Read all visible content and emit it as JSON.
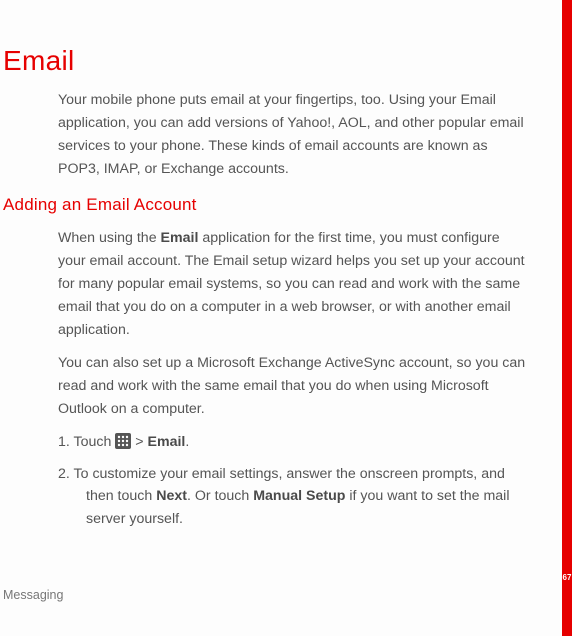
{
  "colors": {
    "accent": "#e60000",
    "text": "#555555"
  },
  "page_number": "67",
  "footer": "Messaging",
  "heading": "Email",
  "intro": "Your mobile phone puts email at your fingertips, too. Using your Email application, you can add versions of Yahoo!, AOL, and other popular email services to your phone. These kinds of email accounts are known as POP3, IMAP, or Exchange accounts.",
  "subheading": "Adding an Email Account",
  "para1_a": "When using the ",
  "para1_bold": "Email",
  "para1_b": " application for the first time, you must configure your email account. The Email setup wizard helps you set up your account for many popular email systems, so you can read and work with the same email that you do on a computer in a web browser, or with another email application.",
  "para2": "You can also set up a Microsoft Exchange ActiveSync account, so you can read and work with the same email that you do when using Microsoft Outlook on a computer.",
  "step1_a": "1. Touch ",
  "step1_gt": " > ",
  "step1_bold": "Email",
  "step1_end": ".",
  "step2_a": "2. To customize your email settings, answer the onscreen prompts, and",
  "step2_hang_a": "then touch ",
  "step2_next": "Next",
  "step2_mid": ". Or touch ",
  "step2_manual": "Manual Setup",
  "step2_tail": " if you want to set the mail server yourself."
}
